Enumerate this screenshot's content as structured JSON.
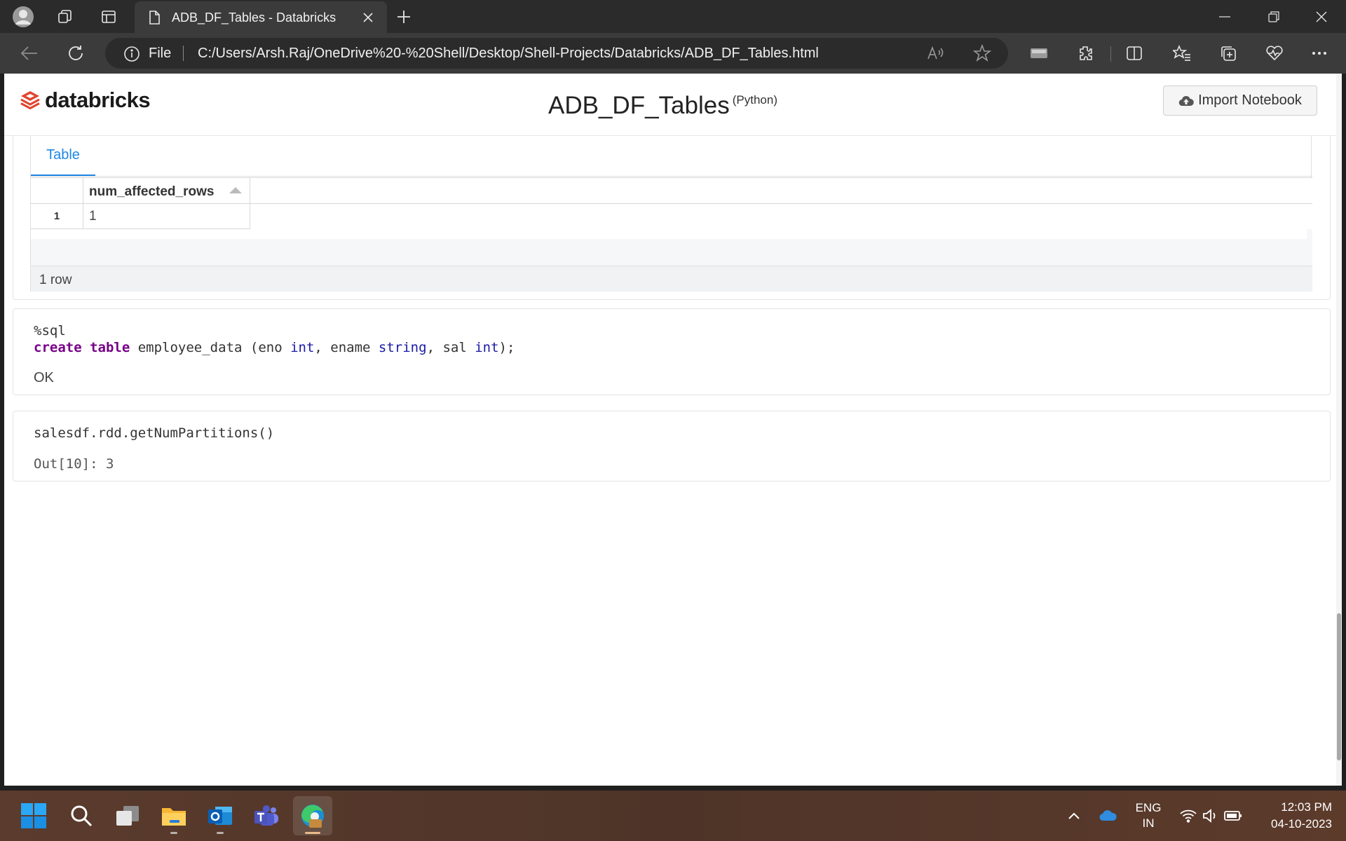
{
  "browser": {
    "tab_title": "ADB_DF_Tables - Databricks",
    "address_scheme_label": "File",
    "url": "C:/Users/Arsh.Raj/OneDrive%20-%20Shell/Desktop/Shell-Projects/Databricks/ADB_DF_Tables.html"
  },
  "page": {
    "logo_text": "databricks",
    "notebook_title": "ADB_DF_Tables",
    "notebook_language": "(Python)",
    "import_button": "Import Notebook"
  },
  "result_cell": {
    "tab_label": "Table",
    "columns": [
      "num_affected_rows"
    ],
    "rows": [
      {
        "index": "1",
        "values": [
          "1"
        ]
      }
    ],
    "row_count": "1 row"
  },
  "sql_cell": {
    "magic": "%sql",
    "code_tokens": [
      {
        "t": "create",
        "c": "kw"
      },
      {
        "t": " ",
        "c": ""
      },
      {
        "t": "table",
        "c": "kw"
      },
      {
        "t": " employee_data (eno ",
        "c": ""
      },
      {
        "t": "int",
        "c": "ty"
      },
      {
        "t": ", ename ",
        "c": ""
      },
      {
        "t": "string",
        "c": "ty"
      },
      {
        "t": ", sal ",
        "c": ""
      },
      {
        "t": "int",
        "c": "ty"
      },
      {
        "t": ");",
        "c": ""
      }
    ],
    "output": "OK"
  },
  "py_cell": {
    "code": "salesdf.rdd.getNumPartitions()",
    "output": "Out[10]: 3"
  },
  "taskbar": {
    "lang_line1": "ENG",
    "lang_line2": "IN",
    "time": "12:03 PM",
    "date": "04-10-2023"
  },
  "colors": {
    "accent_blue": "#1e88e5",
    "sql_keyword": "#770088",
    "sql_type": "#1a1aa6",
    "databricks_red": "#e2452f"
  }
}
